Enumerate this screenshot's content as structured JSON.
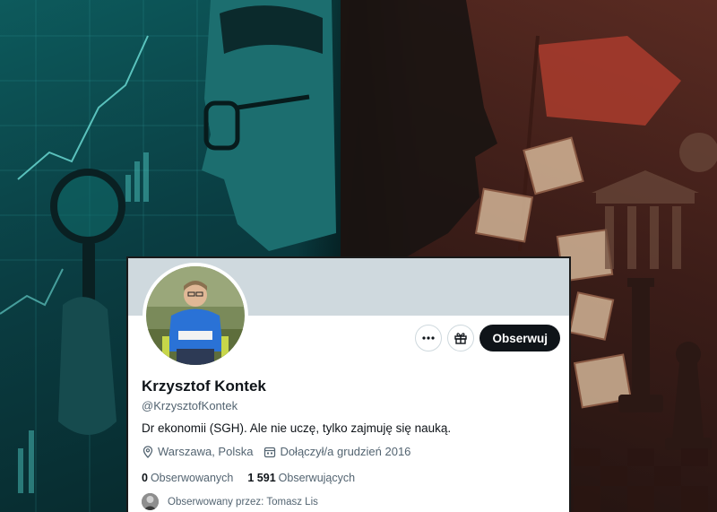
{
  "profile": {
    "name": "Krzysztof Kontek",
    "handle": "@KrzysztofKontek",
    "bio": "Dr ekonomii (SGH). Ale nie uczę, tylko zajmuję się nauką.",
    "location": "Warszawa, Polska",
    "joined": "Dołączył/a grudzień 2016",
    "following_count": "0",
    "following_label": "Obserwowanych",
    "followers_count": "1 591",
    "followers_label": "Obserwujących",
    "followed_by": "Obserwowany przez: Tomasz Lis"
  },
  "actions": {
    "more_icon": "more-icon",
    "subscribe_icon": "gift-icon",
    "follow_label": "Obserwuj"
  },
  "colors": {
    "banner": "#cfd9de",
    "follow_button": "#0f1419",
    "secondary_text": "#536471",
    "bg_left": "#0d5a5c",
    "bg_right": "#5a2b22"
  }
}
